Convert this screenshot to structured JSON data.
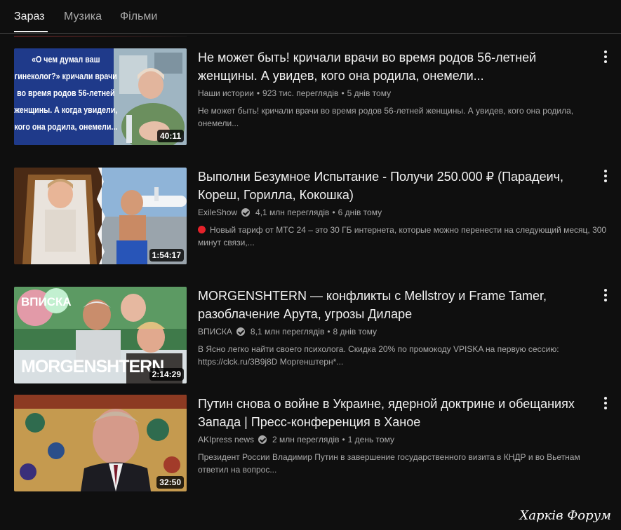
{
  "tabs": [
    {
      "label": "Зараз",
      "active": true
    },
    {
      "label": "Музика",
      "active": false
    },
    {
      "label": "Фільми",
      "active": false
    }
  ],
  "videos": [
    {
      "title": "Не может быть! кричали врачи во время родов 56-летней женщины. А увидев, кого она родила, онемели...",
      "channel": "Наши истории",
      "verified": false,
      "views": "923 тис. переглядів",
      "age": "5 днів тому",
      "description": "Не может быть! кричали врачи во время родов 56-летней женщины. А увидев, кого она родила, онемели...",
      "duration": "40:11",
      "thumb_text": "«О чем думал ваш гинеколог?» кричали врачи во время родов 56-летней женщины. А когда увидели, кого она родила, онемели..."
    },
    {
      "title": "Выполни Безумное Испытание - Получи 250.000 ₽ (Парадеич, Кореш, Горилла, Кокошка)",
      "channel": "ExileShow",
      "verified": true,
      "views": "4,1 млн переглядів",
      "age": "6 днів тому",
      "description": "Новый тариф от МТС 24 – это 30 ГБ интернета, которые можно перенести на следующий месяц, 300 минут связи,...",
      "description_has_red_dot": true,
      "duration": "1:54:17"
    },
    {
      "title": "MORGENSHTERN — конфликты с Mellstroy и Frame Tamer, разоблачение Арута, угрозы Диларе",
      "channel": "ВПИСКА",
      "verified": true,
      "views": "8,1 млн переглядів",
      "age": "8 днів тому",
      "description": "В Ясно легко найти своего психолога. Скидка 20% по промокоду VPISKA на первую сессию: https://clck.ru/3B9j8D Моргенштерн*...",
      "duration": "2:14:29",
      "thumb_logo": "ВПИСКА",
      "thumb_text": "MORGENSHTERN"
    },
    {
      "title": "Путин снова о войне в Украине, ядерной доктрине и обещаниях Запада | Пресс-конференция в Ханое",
      "channel": "AKIpress news",
      "verified": true,
      "views": "2 млн переглядів",
      "age": "1 день тому",
      "description": "Президент России Владимир Путин в завершение государственного визита в КНДР и во Вьетнам ответил на вопрос...",
      "duration": "32:50"
    }
  ],
  "watermark": "Харків Форум",
  "colors": {
    "background": "#0f0f0f",
    "text_primary": "#f1f1f1",
    "text_secondary": "#aaaaaa",
    "red_dot": "#e5222a"
  },
  "icons": {
    "more": "more-vert-icon",
    "verified": "verified-check-icon"
  }
}
